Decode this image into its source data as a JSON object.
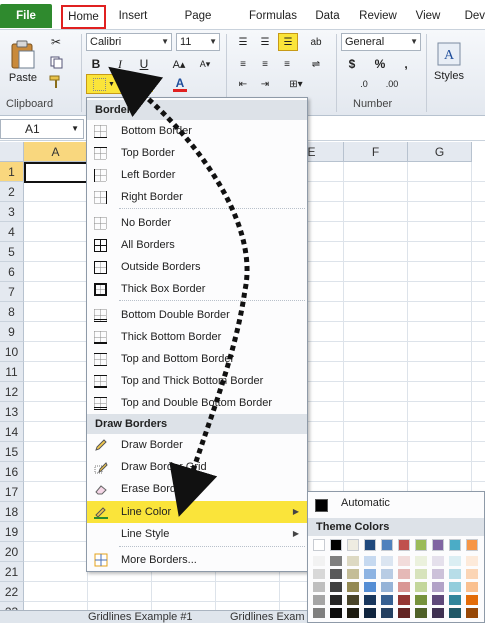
{
  "tabs": {
    "file": "File",
    "home": "Home",
    "insert": "Insert",
    "page_layout": "Page Layout",
    "formulas": "Formulas",
    "data": "Data",
    "review": "Review",
    "view": "View",
    "developer": "Deve"
  },
  "ribbon": {
    "paste_label": "Paste",
    "clipboard_label": "Clipboard",
    "font_name": "Calibri",
    "font_size": "11",
    "bold": "B",
    "italic": "I",
    "underline": "U",
    "font_color_glyph": "A",
    "number_format": "General",
    "currency": "$",
    "percent": "%",
    "comma": ",",
    "number_label": "Number",
    "styles_label": "Styles",
    "accent_yellow": "#fae43a",
    "font_color_red": "#e02020"
  },
  "formula_bar": {
    "name_box": "A1"
  },
  "grid": {
    "columns": [
      "A",
      "B",
      "C",
      "D",
      "E",
      "F",
      "G"
    ],
    "rows": [
      "1",
      "2",
      "3",
      "4",
      "5",
      "6",
      "7",
      "8",
      "9",
      "10",
      "11",
      "12",
      "13",
      "14",
      "15",
      "16",
      "17",
      "18",
      "19",
      "20",
      "21",
      "22",
      "23"
    ]
  },
  "borders_menu": {
    "header_borders": "Borders",
    "items": [
      {
        "label": "Bottom Border",
        "icon": "bottom-border-icon"
      },
      {
        "label": "Top Border",
        "icon": "top-border-icon"
      },
      {
        "label": "Left Border",
        "icon": "left-border-icon"
      },
      {
        "label": "Right Border",
        "icon": "right-border-icon"
      },
      {
        "label": "No Border",
        "icon": "no-border-icon"
      },
      {
        "label": "All Borders",
        "icon": "all-borders-icon"
      },
      {
        "label": "Outside Borders",
        "icon": "outside-borders-icon"
      },
      {
        "label": "Thick Box Border",
        "icon": "thick-box-border-icon"
      },
      {
        "label": "Bottom Double Border",
        "icon": "bottom-double-border-icon"
      },
      {
        "label": "Thick Bottom Border",
        "icon": "thick-bottom-border-icon"
      },
      {
        "label": "Top and Bottom Border",
        "icon": "top-bottom-border-icon"
      },
      {
        "label": "Top and Thick Bottom Border",
        "icon": "top-thick-bottom-border-icon"
      },
      {
        "label": "Top and Double Bottom Border",
        "icon": "top-double-bottom-border-icon"
      }
    ],
    "header_draw": "Draw Borders",
    "draw_items": [
      {
        "label": "Draw Border",
        "icon": "pencil-icon"
      },
      {
        "label": "Draw Border Grid",
        "icon": "pencil-grid-icon"
      },
      {
        "label": "Erase Border",
        "icon": "eraser-icon"
      },
      {
        "label": "Line Color",
        "icon": "line-color-icon"
      },
      {
        "label": "Line Style",
        "icon": "line-style-icon"
      },
      {
        "label": "More Borders...",
        "icon": "more-borders-icon"
      }
    ]
  },
  "color_submenu": {
    "automatic": "Automatic",
    "theme_header": "Theme Colors",
    "theme_top_row": [
      "#ffffff",
      "#000000",
      "#eeece1",
      "#1f497d",
      "#4f81bd",
      "#c0504d",
      "#9bbb59",
      "#8064a2",
      "#4bacc6",
      "#f79646"
    ],
    "theme_shades": [
      [
        "#f2f2f2",
        "#7f7f7f",
        "#ddd9c3",
        "#c6d9f0",
        "#dbe5f1",
        "#f2dcdb",
        "#ebf1dd",
        "#e5e0ec",
        "#dbeef3",
        "#fdeada"
      ],
      [
        "#d8d8d8",
        "#595959",
        "#c4bd97",
        "#8db3e2",
        "#b8cce4",
        "#e5b9b7",
        "#d7e3bc",
        "#ccc1d9",
        "#b7dde8",
        "#fbd5b5"
      ],
      [
        "#bfbfbf",
        "#3f3f3f",
        "#938953",
        "#548dd4",
        "#95b3d7",
        "#d99694",
        "#c3d69b",
        "#b2a2c7",
        "#92cddc",
        "#fac08f"
      ],
      [
        "#a5a5a5",
        "#262626",
        "#494429",
        "#17365d",
        "#366092",
        "#953734",
        "#76923c",
        "#5f497a",
        "#31859b",
        "#e36c09"
      ],
      [
        "#7f7f7f",
        "#0c0c0c",
        "#1d1b10",
        "#0f243e",
        "#244061",
        "#632423",
        "#4f6128",
        "#3f3151",
        "#205867",
        "#974806"
      ]
    ]
  },
  "sheet_tabs": [
    "Gridlines Example #1",
    "Gridlines Exam"
  ]
}
